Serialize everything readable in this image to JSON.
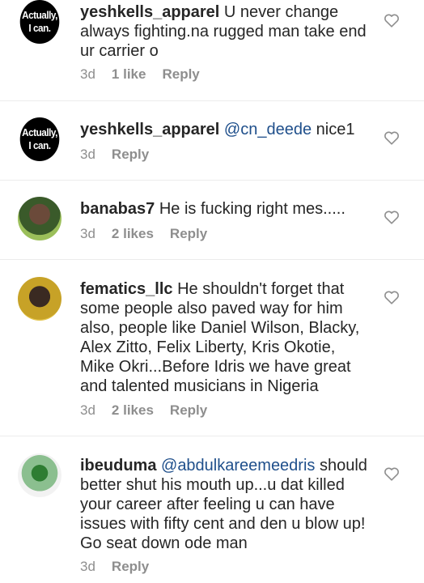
{
  "comments": [
    {
      "avatar_line1": "Actually,",
      "avatar_line2": "I can.",
      "username": "yeshkells_apparel",
      "text": " U never change always fighting.na rugged man take end ur carrier o",
      "time": "3d",
      "likes": "1 like",
      "reply": "Reply"
    },
    {
      "avatar_line1": "Actually,",
      "avatar_line2": "I can.",
      "username": "yeshkells_apparel",
      "mention": " @cn_deede",
      "text": " nice1",
      "time": "3d",
      "reply": "Reply"
    },
    {
      "username": "banabas7",
      "text": " He is fucking right mes.....",
      "time": "3d",
      "likes": "2 likes",
      "reply": "Reply"
    },
    {
      "username": "fematics_llc",
      "text": " He shouldn't forget that some people also paved way for him also, people like Daniel Wilson, Blacky, Alex Zitto, Felix Liberty, Kris Okotie, Mike Okri...Before Idris we have great and talented musicians in Nigeria",
      "time": "3d",
      "likes": "2 likes",
      "reply": "Reply"
    },
    {
      "username": "ibeuduma",
      "mention": " @abdulkareemeedris",
      "text": " should better shut his mouth up...u dat killed your career after feeling u can have issues with fifty cent and den u blow up! Go seat down ode man",
      "time": "3d",
      "reply": "Reply"
    }
  ],
  "icons": {
    "like": "heart-outline-icon"
  }
}
